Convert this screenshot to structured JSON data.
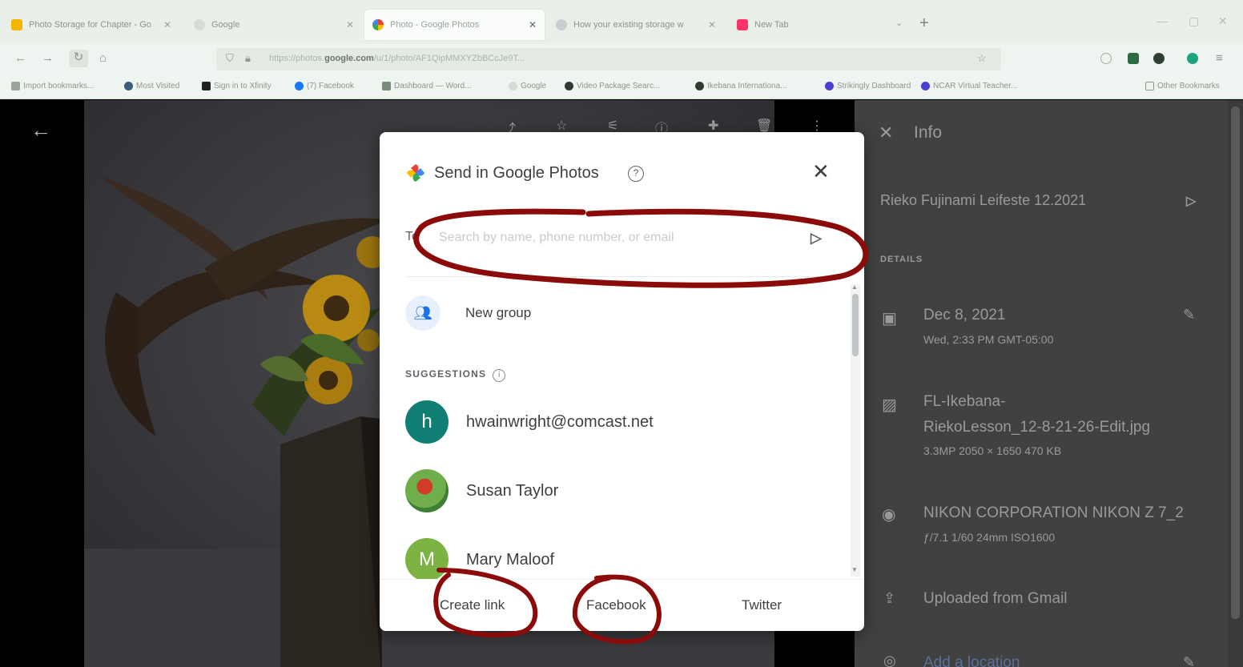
{
  "browser": {
    "tabs": [
      {
        "title": "Photo Storage for Chapter - Go",
        "color": "#f4b400"
      },
      {
        "title": "Google",
        "color": "#d8dcd9"
      },
      {
        "title": "Photo - Google Photos",
        "color": "#ea4335"
      },
      {
        "title": "How your existing storage w",
        "color": "#c9ced0"
      },
      {
        "title": "New Tab",
        "color": "#ff3366"
      }
    ],
    "url": {
      "prefix": "https://photos.",
      "domain": "google.com",
      "path": "/u/1/photo/AF1QipMMXYZbBCcJe9T..."
    },
    "new_tab": "+",
    "tab_dropdown": "⌄",
    "bookmarks": [
      {
        "label": "Import bookmarks...",
        "color": "#9aa39c"
      },
      {
        "label": "Most Visited",
        "color": "#3d5a80"
      },
      {
        "label": "Sign in to Xfinity",
        "color": "#222222"
      },
      {
        "label": "(7) Facebook",
        "color": "#1877f2"
      },
      {
        "label": "Dashboard — Word...",
        "color": "#7c8a7e"
      },
      {
        "label": "Google",
        "color": "#d8dcd9"
      },
      {
        "label": "Video Package Searc...",
        "color": "#2f3a33"
      },
      {
        "label": "Ikebana Internationa...",
        "color": "#2f3a33"
      },
      {
        "label": "Strikingly Dashboard",
        "color": "#4a3fd3"
      },
      {
        "label": "NCAR Virtual Teacher...",
        "color": "#4a3fd3"
      }
    ],
    "other_bookmarks": "Other Bookmarks"
  },
  "dialog": {
    "title": "Send in Google Photos",
    "to_label": "To",
    "search_placeholder": "Search by name, phone number, or email",
    "new_group_label": "New group",
    "suggestions_label": "SUGGESTIONS",
    "contacts": [
      {
        "initial": "h",
        "name": "hwainwright@comcast.net",
        "color": "#0e7f72"
      },
      {
        "initial": "",
        "name": "Susan Taylor",
        "color": "#5c9d4a"
      },
      {
        "initial": "M",
        "name": "Mary Maloof",
        "color": "#7cb342"
      }
    ],
    "share_buttons": [
      "Create link",
      "Facebook",
      "Twitter"
    ]
  },
  "info_panel": {
    "title": "Info",
    "description": "Rieko Fujinami Leifeste 12.2021",
    "details_label": "DETAILS",
    "date": "Dec 8, 2021",
    "time": "Wed, 2:33 PM   GMT-05:00",
    "file_name_1": "FL-Ikebana-",
    "file_name_2": "RiekoLesson_12-8-21-26-Edit.jpg",
    "file_meta": "3.3MP   2050 × 1650   470 KB",
    "camera": "NIKON CORPORATION NIKON Z 7_2",
    "camera_meta": "ƒ/7.1   1/60   24mm   ISO1600",
    "uploaded": "Uploaded from Gmail",
    "location": "Add a location"
  },
  "annotation_color": "#8b0a0a"
}
